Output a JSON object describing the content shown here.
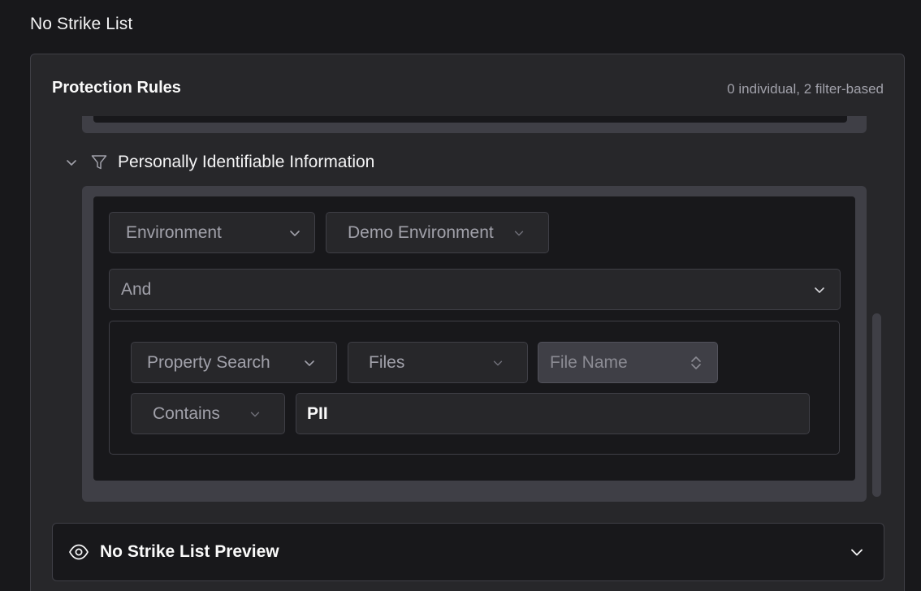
{
  "page": {
    "title": "No Strike List"
  },
  "protection_rules": {
    "title": "Protection Rules",
    "summary": "0 individual, 2 filter-based"
  },
  "rule": {
    "name": "Personally Identifiable Information",
    "collapse_icon": "chevron-down-icon",
    "type_icon": "filter-icon",
    "scope_field": "Environment",
    "scope_value": "Demo Environment",
    "operator": "And",
    "condition": {
      "search_type": "Property Search",
      "object_type": "Files",
      "property": "File Name",
      "comparator": "Contains",
      "value": "PII"
    }
  },
  "preview": {
    "title": "No Strike List Preview",
    "icon": "eye-icon",
    "toggle_icon": "chevron-down-icon"
  }
}
